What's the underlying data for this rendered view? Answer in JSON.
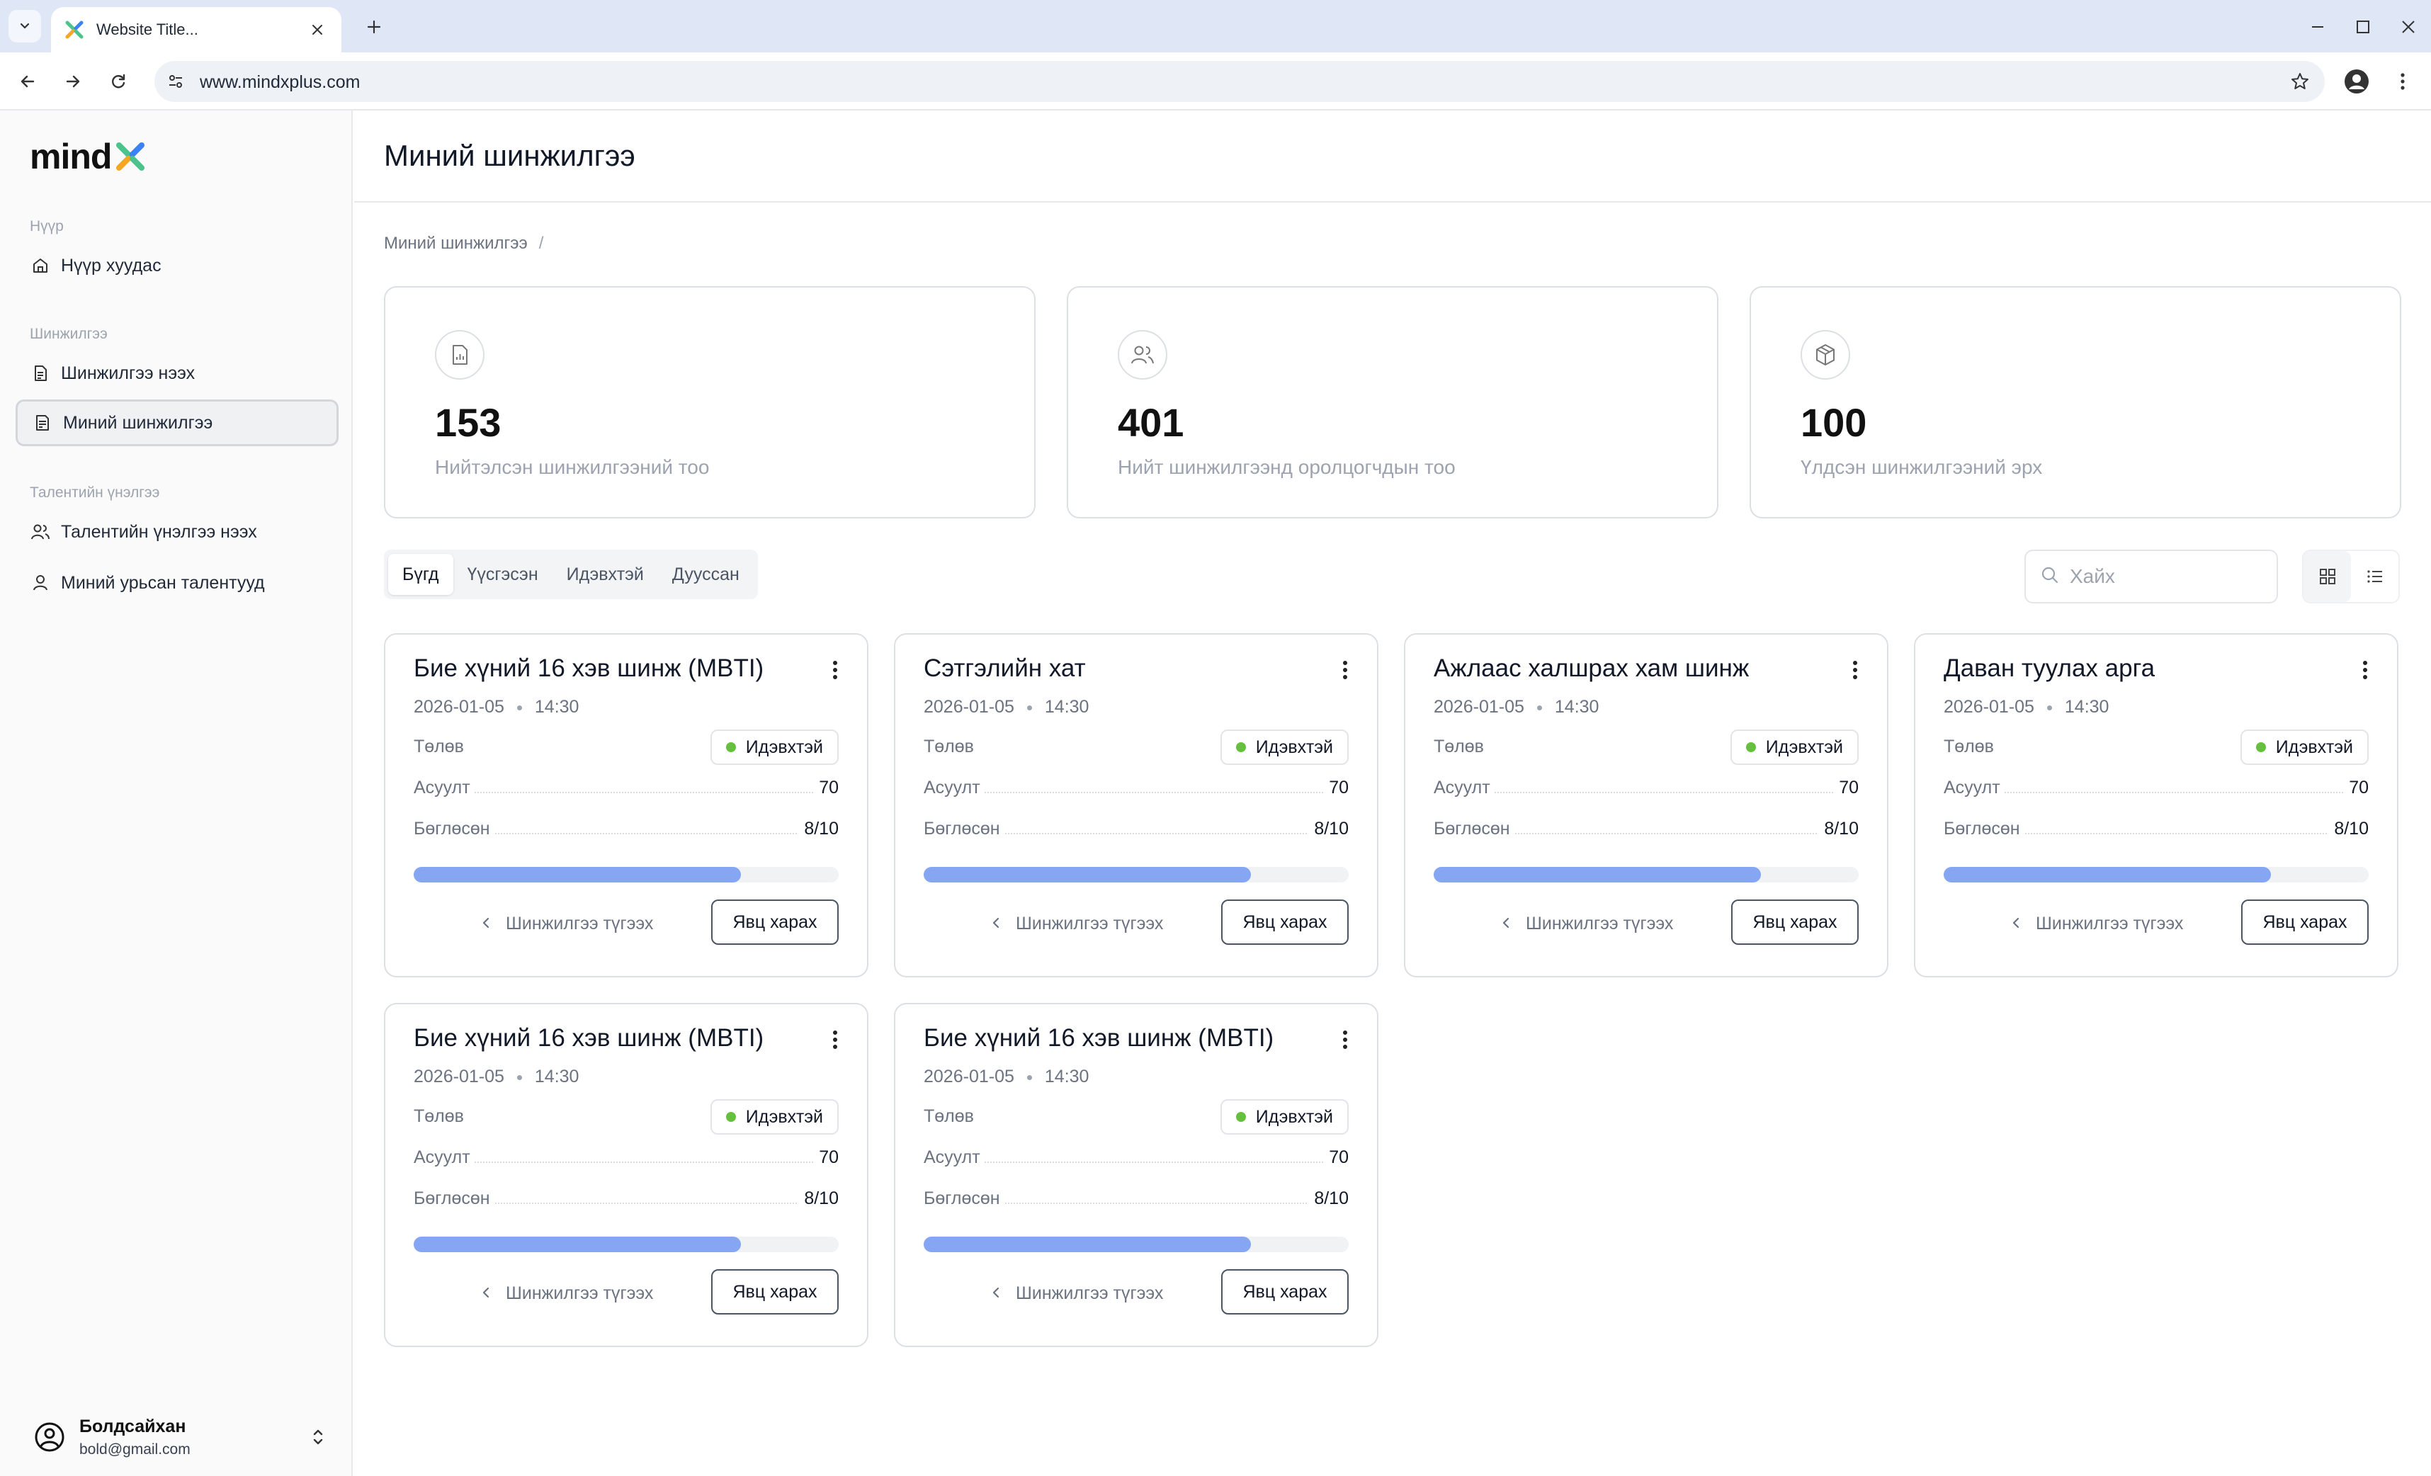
{
  "browser": {
    "tab_title": "Website Title...",
    "url": "www.mindxplus.com"
  },
  "sidebar": {
    "logo": "mind",
    "sections": [
      {
        "title": "Нүүр",
        "items": [
          {
            "label": "Нүүр хуудас",
            "icon": "home-icon"
          }
        ]
      },
      {
        "title": "Шинжилгээ",
        "items": [
          {
            "label": "Шинжилгээ нээх",
            "icon": "document-icon"
          },
          {
            "label": "Миний шинжилгээ",
            "icon": "document-list-icon",
            "active": true
          }
        ]
      },
      {
        "title": "Талентийн үнэлгээ",
        "items": [
          {
            "label": "Талентийн үнэлгээ нээх",
            "icon": "users-icon"
          },
          {
            "label": "Миний урьсан талентууд",
            "icon": "user-icon"
          }
        ]
      }
    ],
    "user": {
      "name": "Болдсайхан",
      "email": "bold@gmail.com"
    }
  },
  "main": {
    "title": "Миний шинжилгээ",
    "breadcrumb": {
      "current": "Миний шинжилгээ",
      "separator": "/"
    },
    "stats": [
      {
        "value": "153",
        "label": "Нийтэлсэн шинжилгээний тоо",
        "icon": "chart-document-icon"
      },
      {
        "value": "401",
        "label": "Нийт шинжилгээнд оролцогчдын тоо",
        "icon": "users-icon"
      },
      {
        "value": "100",
        "label": "Үлдсэн шинжилгээний эрх",
        "icon": "box-icon"
      }
    ],
    "filters": [
      "Бүгд",
      "Үүсгэсэн",
      "Идэвхтэй",
      "Дууссан"
    ],
    "active_filter": "Бүгд",
    "search": {
      "placeholder": "Хайх",
      "value": ""
    },
    "view_mode": "grid"
  },
  "card_labels": {
    "status": "Төлөв",
    "questions": "Асуулт",
    "completed": "Бөглөсөн",
    "stop_link": "Шинжилгээ түгээх",
    "view_button": "Явц харах"
  },
  "cards": [
    {
      "title": "Бие хүний 16 хэв шинж (MBTI)",
      "date": "2026-01-05",
      "time": "14:30",
      "status": "Идэвхтэй",
      "questions": "70",
      "completed": "8/10",
      "progress": 0.77
    },
    {
      "title": "Сэтгэлийн хат",
      "date": "2026-01-05",
      "time": "14:30",
      "status": "Идэвхтэй",
      "questions": "70",
      "completed": "8/10",
      "progress": 0.77
    },
    {
      "title": "Ажлаас халшрах хам шинж",
      "date": "2026-01-05",
      "time": "14:30",
      "status": "Идэвхтэй",
      "questions": "70",
      "completed": "8/10",
      "progress": 0.77
    },
    {
      "title": "Даван туулах арга",
      "date": "2026-01-05",
      "time": "14:30",
      "status": "Идэвхтэй",
      "questions": "70",
      "completed": "8/10",
      "progress": 0.77
    },
    {
      "title": "Бие хүний 16 хэв шинж (MBTI)",
      "date": "2026-01-05",
      "time": "14:30",
      "status": "Идэвхтэй",
      "questions": "70",
      "completed": "8/10",
      "progress": 0.77
    },
    {
      "title": "Бие хүний 16 хэв шинж (MBTI)",
      "date": "2026-01-05",
      "time": "14:30",
      "status": "Идэвхтэй",
      "questions": "70",
      "completed": "8/10",
      "progress": 0.77
    }
  ],
  "colors": {
    "accent_progress": "#86a6f3",
    "status_active": "#65c13d",
    "logo_green": "#4cc38a",
    "logo_orange": "#f5a623",
    "logo_blue": "#3b82f6"
  }
}
